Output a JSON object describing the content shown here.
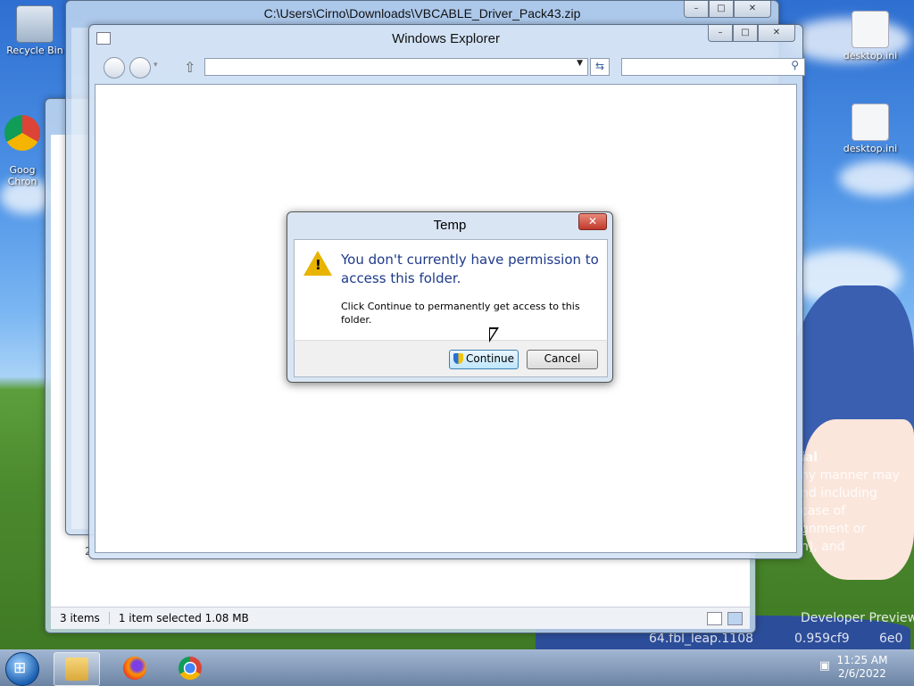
{
  "desktop": {
    "icons": [
      {
        "label": "Recycle Bin"
      },
      {
        "label": "Goog\nChron"
      },
      {
        "label": "desktop.ini"
      },
      {
        "label": "desktop.ini"
      }
    ],
    "bg_text_lines": [
      "ial",
      "ny manner may",
      "nd including",
      "case of",
      "gnment or",
      "n), and",
      "Developer Preview",
      "64.fbl_leap.1108",
      "0.959cf9",
      "6e0"
    ]
  },
  "windows": {
    "back": {
      "status": {
        "items_count": "3 items",
        "selection": "1 item selected  1.08 MB"
      },
      "side_number": "2"
    },
    "zip": {
      "title": "C:\\Users\\Cirno\\Downloads\\VBCABLE_Driver_Pack43.zip"
    },
    "explorer": {
      "title": "Windows Explorer",
      "address_value": "",
      "search_placeholder": ""
    }
  },
  "dialog": {
    "title": "Temp",
    "main_instruction": "You don't currently have permission to access this folder.",
    "sub_instruction": "Click Continue to permanently get access to this folder.",
    "continue_label": "Continue",
    "cancel_label": "Cancel",
    "close_glyph": "✕"
  },
  "caption_glyphs": {
    "min": "–",
    "max": "□",
    "close": "✕"
  },
  "taskbar": {
    "time": "11:25 AM",
    "date": "2/6/2022"
  }
}
